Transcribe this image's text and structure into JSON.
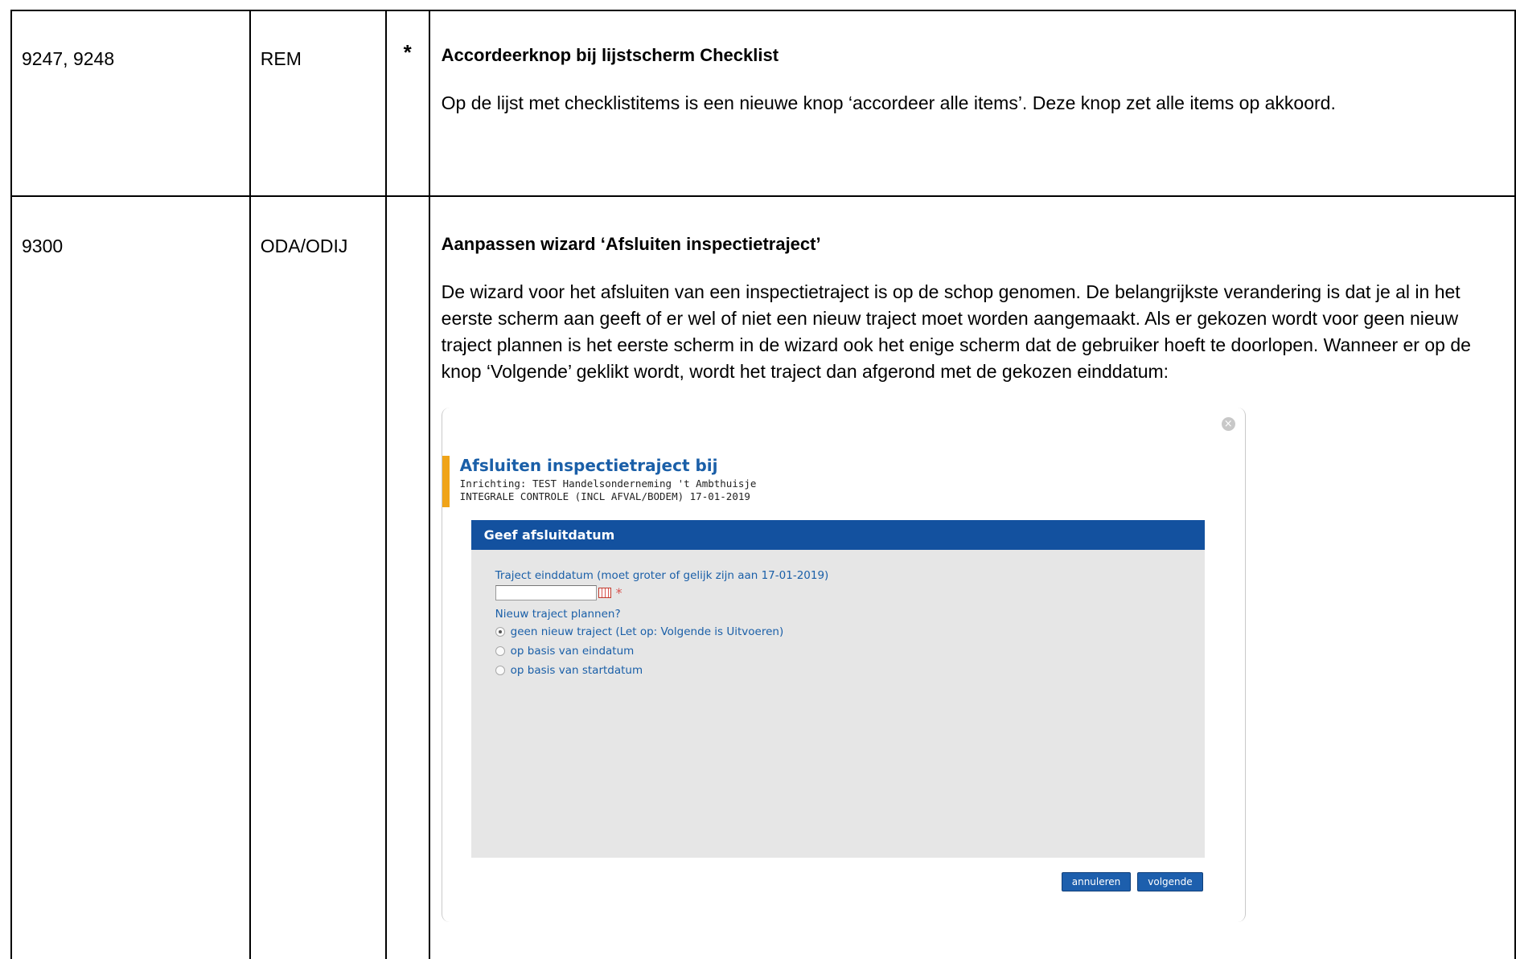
{
  "rows": [
    {
      "id": "9247, 9248",
      "entity": "REM",
      "mark": "*",
      "title": "Accordeerknop bij lijstscherm Checklist",
      "body": "Op de lijst met checklistitems is een nieuwe knop ‘accordeer alle items’. Deze knop zet alle items op akkoord."
    },
    {
      "id": "9300",
      "entity": "ODA/ODIJ",
      "mark": "",
      "title": "Aanpassen wizard ‘Afsluiten inspectietraject’",
      "body": "De wizard voor het afsluiten van een inspectietraject is op de schop genomen. De belangrijkste verandering is dat je al in het eerste scherm aan geeft of er wel of niet een nieuw traject moet worden aangemaakt. Als er gekozen wordt voor geen nieuw traject plannen is het eerste scherm in de wizard ook het enige scherm dat de gebruiker hoeft te doorlopen. Wanneer er op de knop ‘Volgende’ geklikt wordt, wordt het traject dan afgerond met de gekozen einddatum:"
    }
  ],
  "dialog": {
    "title": "Afsluiten inspectietraject bij",
    "subtitle1": "Inrichting: TEST Handelsonderneming 't Ambthuisje",
    "subtitle2": "INTEGRALE CONTROLE (INCL AFVAL/BODEM) 17-01-2019",
    "close_icon": "close-icon",
    "panel_title": "Geef afsluitdatum",
    "date_label": "Traject einddatum (moet groter of gelijk zijn aan 17-01-2019)",
    "date_value": "",
    "required_marker": "*",
    "plan_label": "Nieuw traject plannen?",
    "options": [
      {
        "label": "geen nieuw traject (Let op: Volgende is Uitvoeren)",
        "selected": true
      },
      {
        "label": "op basis van eindatum",
        "selected": false
      },
      {
        "label": "op basis van startdatum",
        "selected": false
      }
    ],
    "cancel_label": "annuleren",
    "next_label": "volgende",
    "colors": {
      "accent": "#f0a419",
      "panel_header": "#13519f",
      "title": "#1a5fa8",
      "panel_bg": "#e6e6e6"
    }
  }
}
